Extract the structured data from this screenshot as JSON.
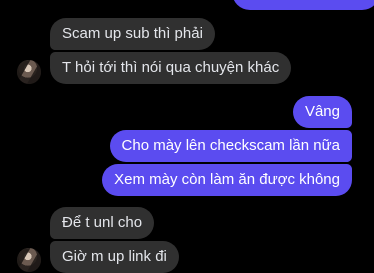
{
  "conversation": {
    "messages": [
      {
        "direction": "in",
        "text": "Scam up sub thì phải"
      },
      {
        "direction": "in",
        "text": "T hỏi tới thì nói qua chuyện khác"
      },
      {
        "direction": "out",
        "text": "Vâng"
      },
      {
        "direction": "out",
        "text": "Cho mày lên checkscam lần nữa"
      },
      {
        "direction": "out",
        "text": "Xem mày còn làm ăn được không"
      },
      {
        "direction": "in",
        "text": "Để t unl cho"
      },
      {
        "direction": "in",
        "text": "Giờ m up link đi"
      }
    ]
  },
  "colors": {
    "background": "#000000",
    "incoming_bubble": "#303030",
    "outgoing_bubble": "#5b4cf0",
    "incoming_text": "#e4e6eb",
    "outgoing_text": "#ffffff"
  }
}
